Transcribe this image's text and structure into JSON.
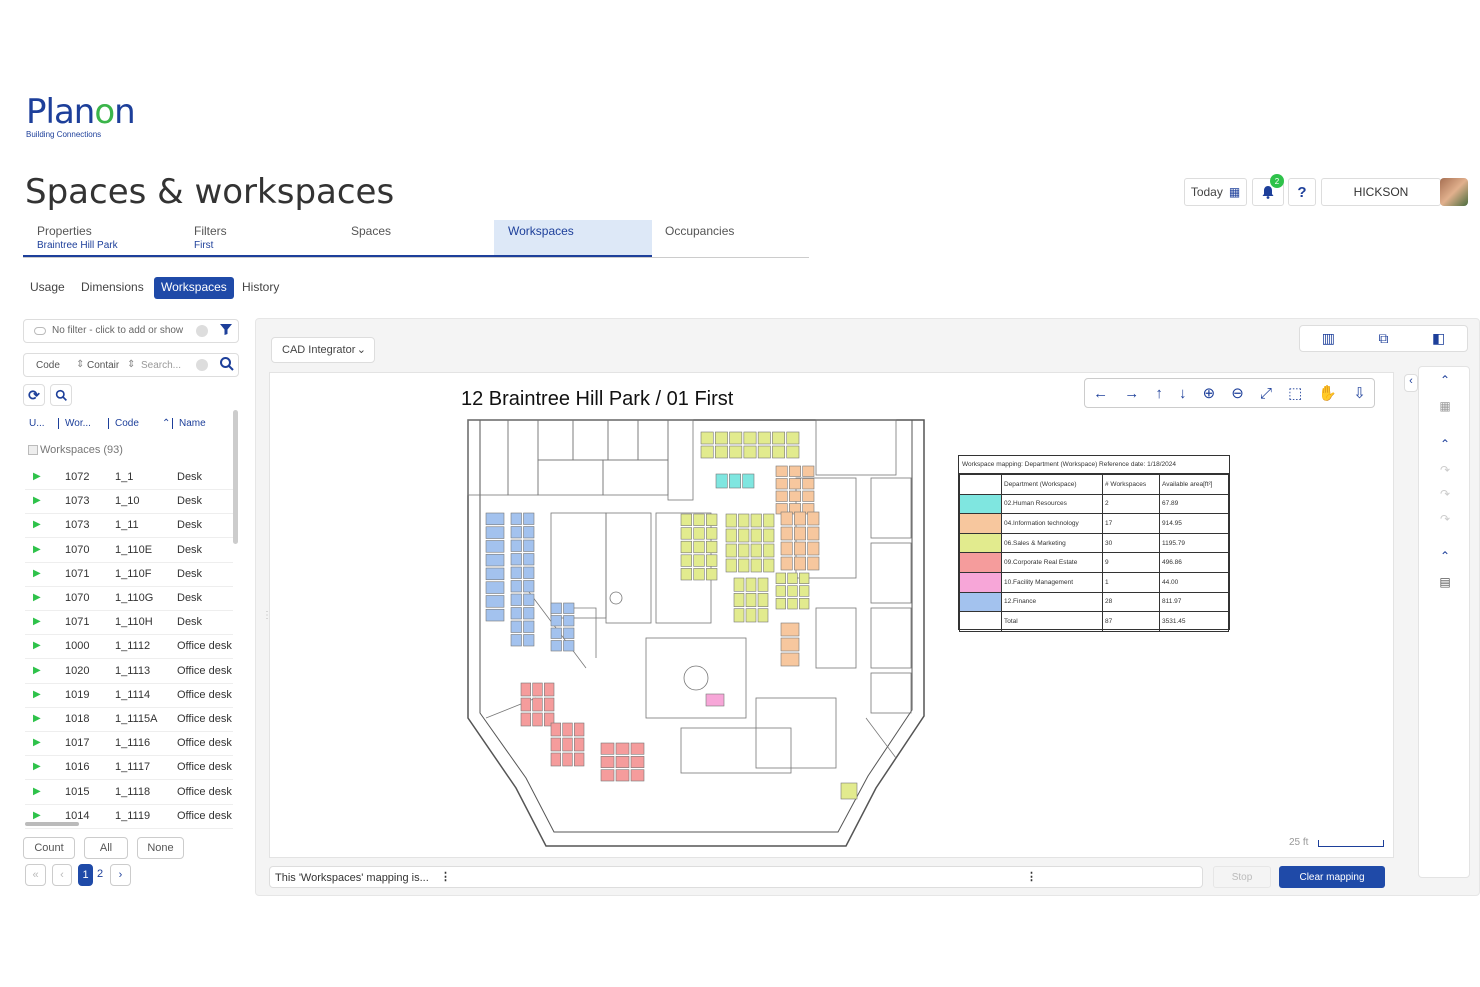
{
  "brand": {
    "name_pre": "Plan",
    "name_o": "o",
    "name_post": "n",
    "tagline": "Building Connections"
  },
  "page_title": "Spaces & workspaces",
  "header": {
    "today_label": "Today",
    "notifications_count": "2",
    "help_label": "?",
    "user_name": "HICKSON"
  },
  "crumbs": [
    {
      "label": "Properties",
      "sub": "Braintree Hill Park"
    },
    {
      "label": "Filters",
      "sub": "First"
    },
    {
      "label": "Spaces",
      "sub": ""
    },
    {
      "label": "Workspaces",
      "sub": ""
    },
    {
      "label": "Occupancies",
      "sub": ""
    }
  ],
  "subtabs": [
    "Usage",
    "Dimensions",
    "Workspaces",
    "History"
  ],
  "left": {
    "filter_placeholder": "No filter - click to add or show",
    "search_field": "Code",
    "search_op": "Contair",
    "search_placeholder": "Search...",
    "columns": [
      "U...",
      "Wor...",
      "Code",
      "Name"
    ],
    "group_label": "Workspaces (93)",
    "rows": [
      {
        "wor": "1072",
        "code": "1_1",
        "name": "Desk"
      },
      {
        "wor": "1073",
        "code": "1_10",
        "name": "Desk"
      },
      {
        "wor": "1073",
        "code": "1_11",
        "name": "Desk"
      },
      {
        "wor": "1070",
        "code": "1_110E",
        "name": "Desk"
      },
      {
        "wor": "1071",
        "code": "1_110F",
        "name": "Desk"
      },
      {
        "wor": "1070",
        "code": "1_110G",
        "name": "Desk"
      },
      {
        "wor": "1071",
        "code": "1_110H",
        "name": "Desk"
      },
      {
        "wor": "1000",
        "code": "1_1112",
        "name": "Office desk"
      },
      {
        "wor": "1020",
        "code": "1_1113",
        "name": "Office desk"
      },
      {
        "wor": "1019",
        "code": "1_1114",
        "name": "Office desk"
      },
      {
        "wor": "1018",
        "code": "1_1115A",
        "name": "Office desk"
      },
      {
        "wor": "1017",
        "code": "1_1116",
        "name": "Office desk"
      },
      {
        "wor": "1016",
        "code": "1_1117",
        "name": "Office desk"
      },
      {
        "wor": "1015",
        "code": "1_1118",
        "name": "Office desk"
      },
      {
        "wor": "1014",
        "code": "1_1119",
        "name": "Office desk"
      }
    ],
    "count_label": "Count",
    "all_label": "All",
    "none_label": "None",
    "pages": [
      "1",
      "2"
    ]
  },
  "main": {
    "dropdown": "CAD Integrator",
    "plan_title": "12 Braintree Hill Park / 01 First",
    "scale": "25 ft",
    "status_text": "This 'Workspaces' mapping is...",
    "stop_label": "Stop",
    "clear_label": "Clear mapping"
  },
  "legend": {
    "title": "Workspace mapping: Department (Workspace) Reference date: 1/18/2024",
    "headers": [
      "Department (Workspace)",
      "# Workspaces",
      "Available area[ft²]"
    ],
    "rows": [
      {
        "color": "#7fe6e0",
        "dept": "02.Human Resources",
        "count": "2",
        "area": "67.89"
      },
      {
        "color": "#f7c79e",
        "dept": "04.Information technology",
        "count": "17",
        "area": "914.95"
      },
      {
        "color": "#e2eb8e",
        "dept": "06.Sales & Marketing",
        "count": "30",
        "area": "1195.79"
      },
      {
        "color": "#f59c9c",
        "dept": "09.Corporate Real Estate",
        "count": "9",
        "area": "496.86"
      },
      {
        "color": "#f7a6d8",
        "dept": "10.Facility Management",
        "count": "1",
        "area": "44.00"
      },
      {
        "color": "#a3c2ee",
        "dept": "12.Finance",
        "count": "28",
        "area": "811.97"
      }
    ],
    "total_label": "Total",
    "total_count": "87",
    "total_area": "3531.45"
  },
  "colors": {
    "brand_blue": "#1d3f9a",
    "accent_green": "#2ec24a",
    "active_tab": "#dde8f7",
    "primary_button": "#1f4aa8"
  }
}
